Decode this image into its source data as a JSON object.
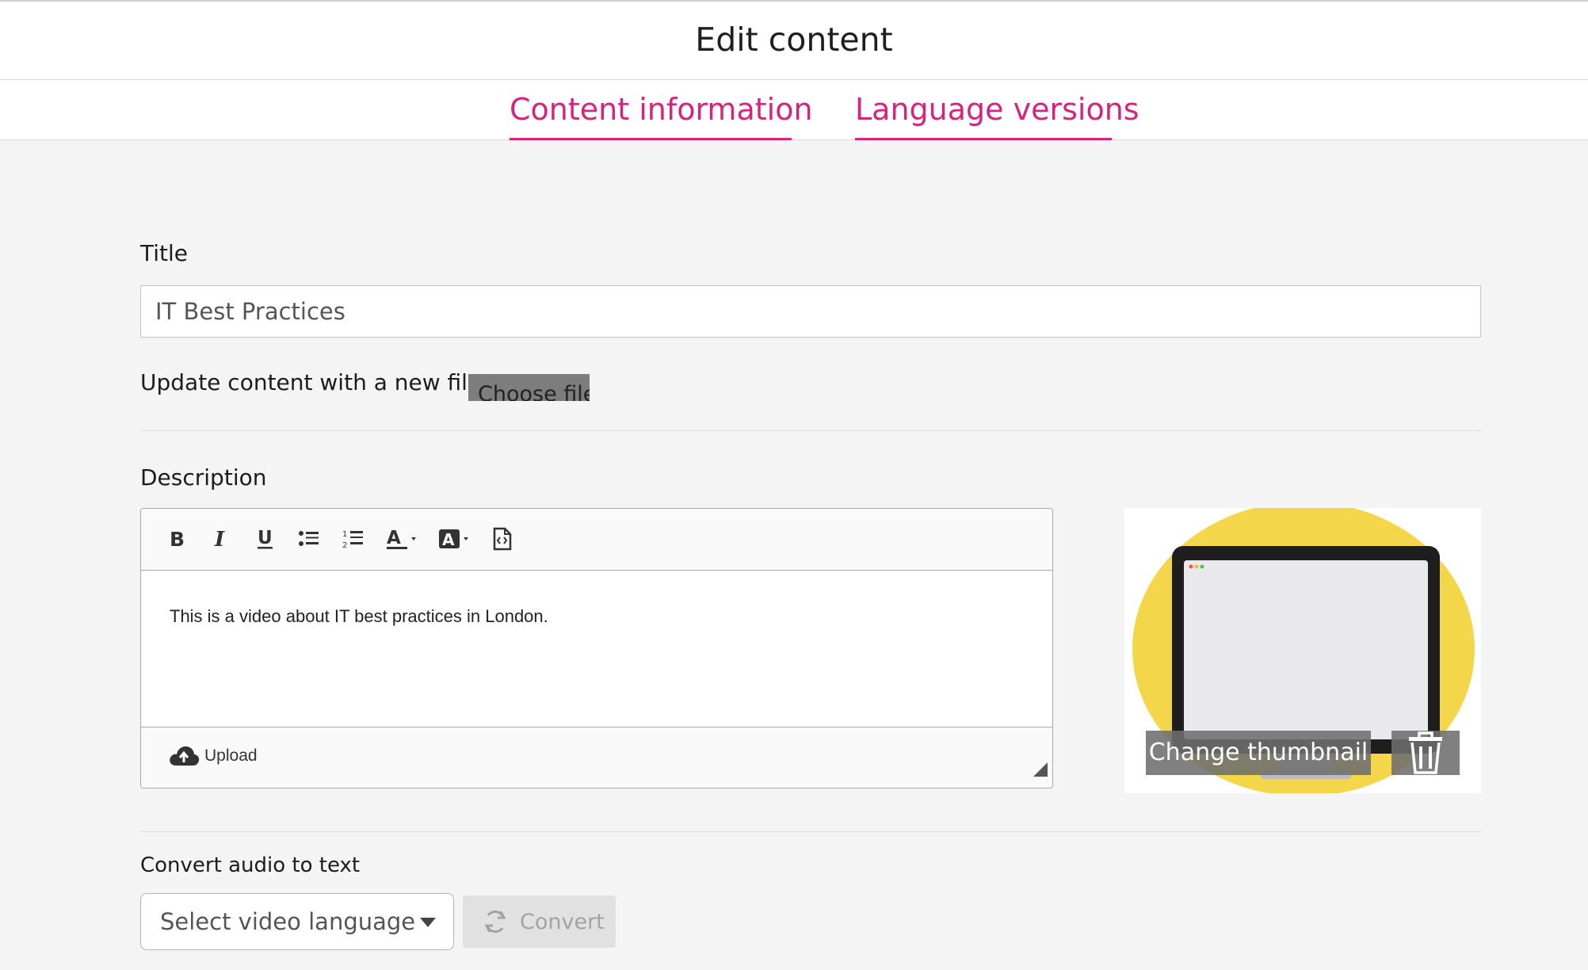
{
  "header": {
    "title": "Edit content"
  },
  "tabs": [
    {
      "label": "Content information"
    },
    {
      "label": "Language versions"
    }
  ],
  "form": {
    "title_label": "Title",
    "title_value": "IT Best Practices",
    "file_label": "Update content with a new file",
    "choose_file_label": "Choose file",
    "description_label": "Description",
    "description_text": "This is a video about IT best practices in London.",
    "upload_label": "Upload",
    "toolbar_icons": [
      "bold-icon",
      "italic-icon",
      "underline-icon",
      "bullet-list-icon",
      "numbered-list-icon",
      "text-color-icon",
      "background-color-icon",
      "source-code-icon"
    ],
    "convert_label": "Convert audio to text",
    "language_placeholder": "Select video language",
    "convert_button_label": "Convert"
  },
  "thumbnail": {
    "change_label": "Change thumbnail",
    "delete_icon": "trash-icon",
    "colors": {
      "circle": "#f4d64a",
      "monitor": "#1e1e1e",
      "screen": "#e9e9ec"
    }
  },
  "colors": {
    "accent": "#d6237f",
    "background": "#f4f4f4"
  }
}
